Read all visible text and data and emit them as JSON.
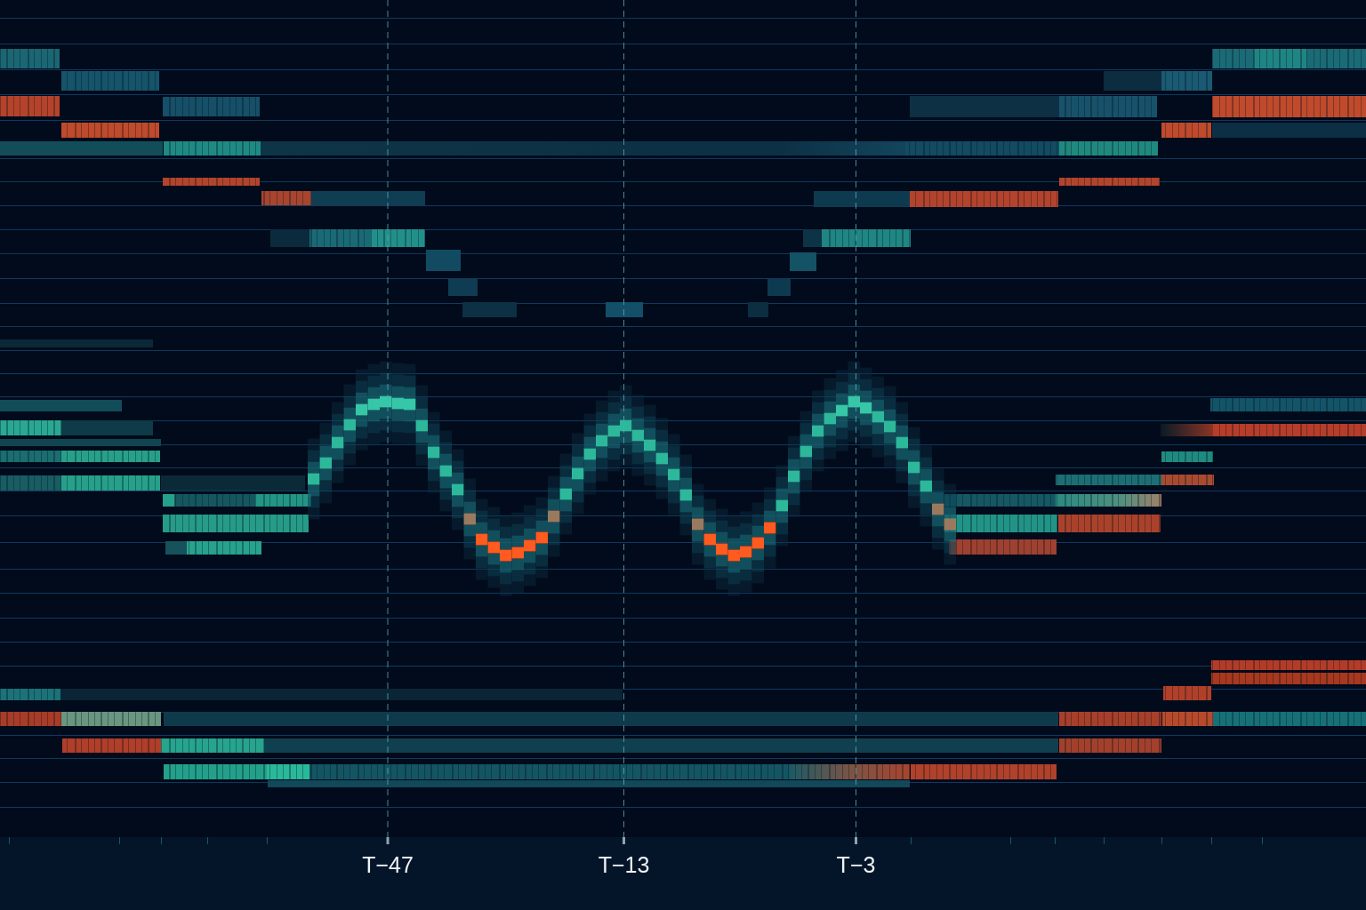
{
  "chart": {
    "x_axis": {
      "labels": [
        "T−47",
        "T−13",
        "T−3"
      ]
    }
  }
}
